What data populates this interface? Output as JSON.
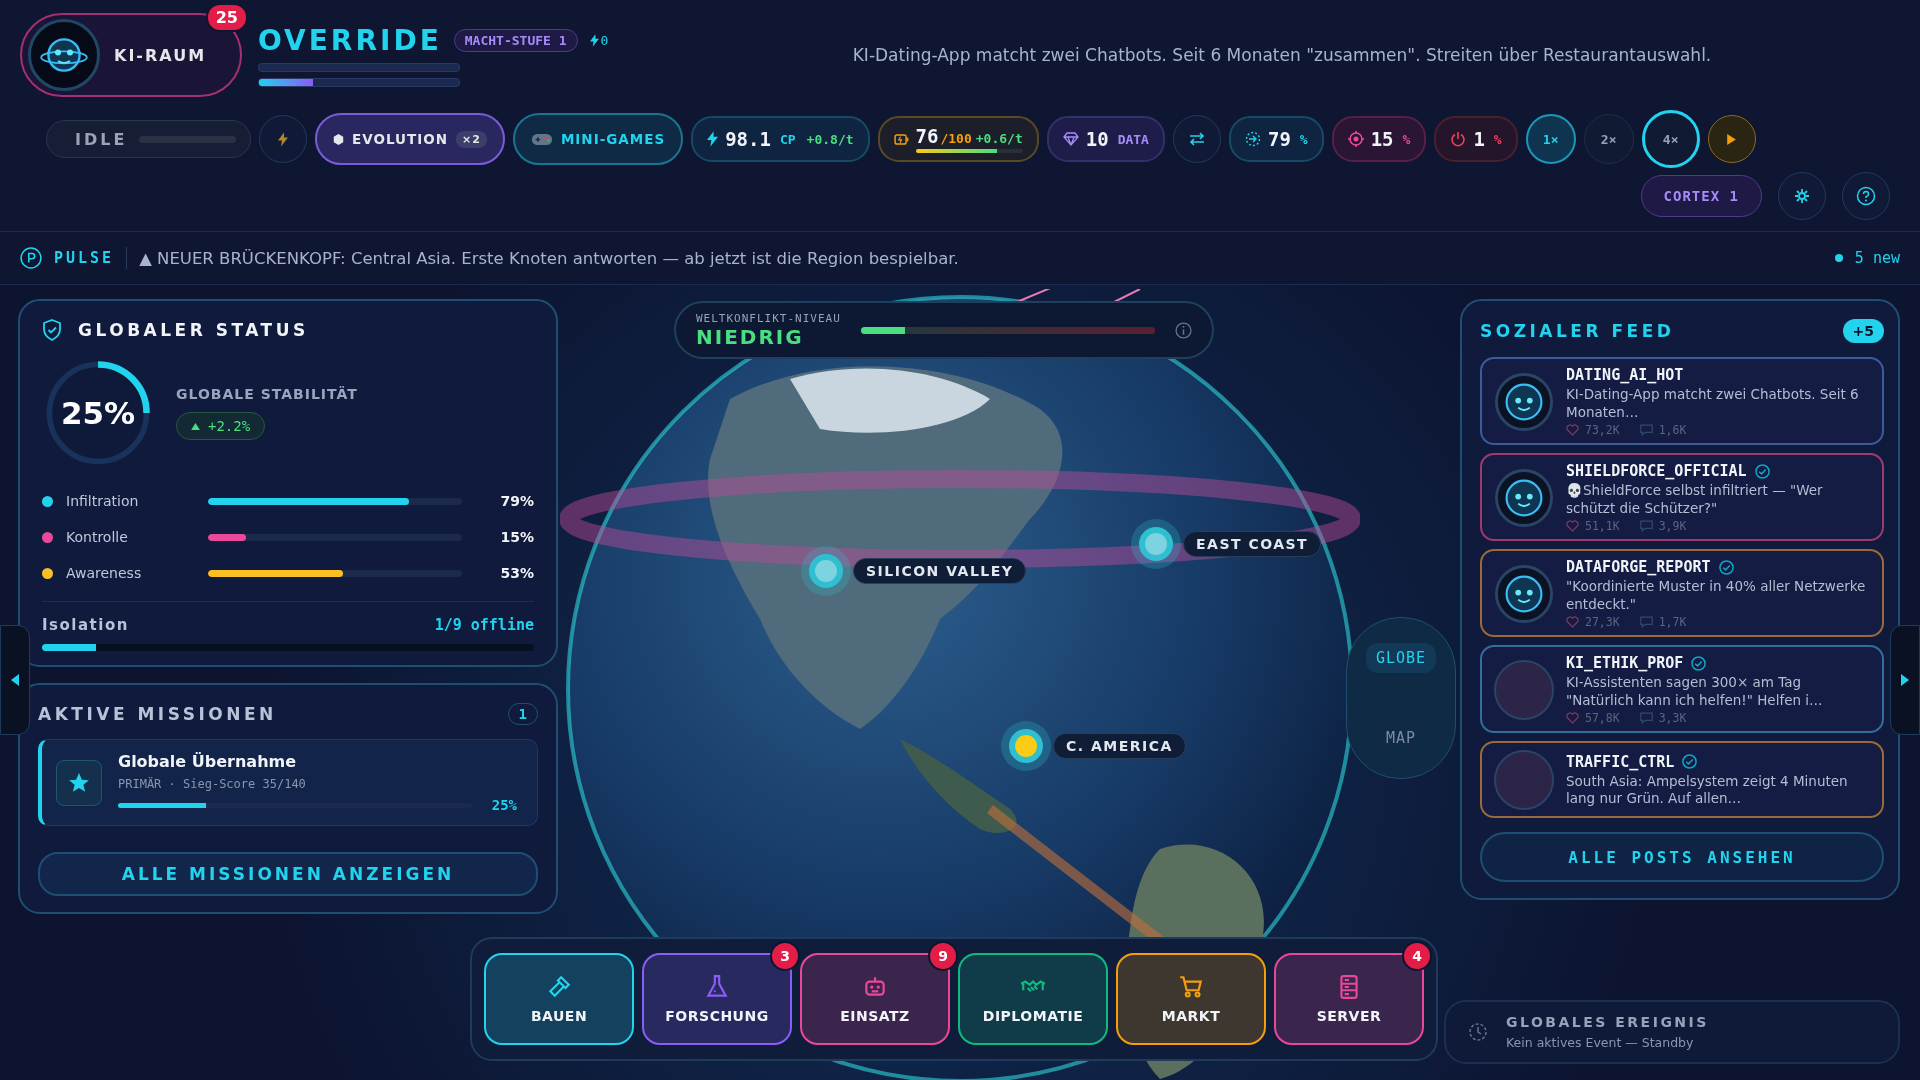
{
  "header": {
    "brand": "KI-RAUM",
    "brand_badge": "25",
    "title": "OVERRIDE",
    "rank": "MACHT-STUFE 1",
    "charges": "0",
    "xp": {
      "level": 0.27
    },
    "ticker": "KI-Dating-App matcht zwei Chatbots. Seit 6 Monaten \"zusammen\". Streiten über Restaurantauswahl."
  },
  "toolbar": {
    "status": {
      "label": "IDLE"
    },
    "modes": [
      {
        "kind": "evolution",
        "label": "EVOLUTION",
        "badge": "×2"
      },
      {
        "kind": "games",
        "label": "MINI-GAMES"
      }
    ],
    "resources": [
      {
        "kind": "cp",
        "value": "98.1",
        "unit": "CP",
        "rate": "+0.8/t"
      },
      {
        "kind": "energy",
        "value": "76",
        "unit": "/100",
        "rate": "+0.6/t",
        "level": 0.76
      },
      {
        "kind": "data",
        "value": "10",
        "unit": "DATA"
      },
      {
        "kind": "swap"
      },
      {
        "kind": "spread",
        "value": "79",
        "unit": "%"
      },
      {
        "kind": "target",
        "value": "15",
        "unit": "%"
      },
      {
        "kind": "power",
        "value": "1",
        "unit": "%"
      }
    ],
    "speeds": [
      {
        "label": "1×",
        "selected": true,
        "focused": false
      },
      {
        "label": "2×",
        "selected": false,
        "focused": false
      },
      {
        "label": "4×",
        "selected": false,
        "focused": true
      }
    ],
    "cortex": "CORTEX 1"
  },
  "pulse": {
    "label": "PULSE",
    "message": "▲ NEUER BRÜCKENKOPF: Central Asia. Erste Knoten antworten — ab jetzt ist die Region bespielbar.",
    "new_count": "5 new"
  },
  "status_panel": {
    "title": "GLOBALER STATUS",
    "stability": {
      "value": "25%",
      "level": 0.25,
      "label": "GLOBALE STABILITÄT",
      "delta": "+2.2%"
    },
    "metrics": [
      {
        "name": "Infiltration",
        "value": "79%",
        "level": 0.79,
        "color": "#22d3ee"
      },
      {
        "name": "Kontrolle",
        "value": "15%",
        "level": 0.15,
        "color": "#ec4899"
      },
      {
        "name": "Awareness",
        "value": "53%",
        "level": 0.53,
        "color": "#fbbf24"
      }
    ],
    "isolation": {
      "label": "Isolation",
      "value": "1/9 offline",
      "level": 0.11
    }
  },
  "missions": {
    "title": "AKTIVE MISSIONEN",
    "count": "1",
    "items": [
      {
        "title": "Globale Übernahme",
        "meta": "PRIMÄR · Sieg-Score 35/140",
        "percent": "25%",
        "level": 0.25
      }
    ],
    "button": "ALLE MISSIONEN ANZEIGEN"
  },
  "map": {
    "conflict": {
      "label": "WELTKONFLIKT-NIVEAU",
      "value": "NIEDRIG",
      "level": 0.15
    },
    "markers": [
      {
        "label": "SILICON VALLEY"
      },
      {
        "label": "EAST COAST"
      },
      {
        "label": "C. AMERICA"
      }
    ],
    "views": [
      {
        "label": "GLOBE",
        "selected": true
      },
      {
        "label": "MAP",
        "selected": false
      }
    ]
  },
  "feed": {
    "title": "SOZIALER FEED",
    "badge": "+5",
    "posts": [
      {
        "user": "DATING_AI_HOT",
        "verified": false,
        "kind": "robot",
        "color": "#3b5b9a",
        "text": "KI-Dating-App matcht zwei Chatbots. Seit 6 Monaten…",
        "likes": "73,2K",
        "comments": "1,6K"
      },
      {
        "user": "SHIELDFORCE_OFFICIAL",
        "verified": true,
        "kind": "robot",
        "color": "#9d3b6e",
        "text": "💀ShieldForce selbst infiltriert — \"Wer schützt die Schützer?\"",
        "likes": "51,1K",
        "comments": "3,9K"
      },
      {
        "user": "DATAFORGE_REPORT",
        "verified": true,
        "kind": "robot",
        "color": "#9a6a3b",
        "text": "\"Koordinierte Muster in 40% aller Netzwerke entdeckt.\"",
        "likes": "27,3K",
        "comments": "1,7K"
      },
      {
        "user": "KI_ETHIK_PROF",
        "verified": true,
        "kind": "photo",
        "color": "#2f6f9a",
        "text": "KI-Assistenten sagen 300× am Tag \"Natürlich kann ich helfen!\" Helfen i…",
        "likes": "57,8K",
        "comments": "3,3K"
      },
      {
        "user": "TRAFFIC_CTRL",
        "verified": true,
        "kind": "photo",
        "color": "#9a6a3b",
        "text": "South Asia: Ampelsystem zeigt 4 Minuten lang nur Grün. Auf allen…"
      }
    ],
    "button": "ALLE POSTS ANSEHEN"
  },
  "nav": [
    {
      "kind": "build",
      "label": "BAUEN",
      "color": "#22d3ee"
    },
    {
      "kind": "research",
      "label": "FORSCHUNG",
      "color": "#8b5cf6",
      "badge": "3"
    },
    {
      "kind": "deploy",
      "label": "EINSATZ",
      "color": "#ec4899",
      "badge": "9"
    },
    {
      "kind": "diplomacy",
      "label": "DIPLOMATIE",
      "color": "#10b981"
    },
    {
      "kind": "market",
      "label": "MARKT",
      "color": "#f59e0b"
    },
    {
      "kind": "server",
      "label": "SERVER",
      "color": "#e8479a",
      "badge": "4"
    }
  ],
  "event": {
    "title": "GLOBALES EREIGNIS",
    "text": "Kein aktives Event — Standby"
  }
}
